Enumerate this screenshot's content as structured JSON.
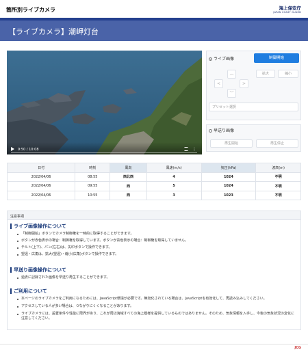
{
  "header": {
    "site_title": "箇所別ライブカメラ",
    "logo_jp": "海上保安庁",
    "logo_en": "JAPAN COAST GUARD"
  },
  "banner": {
    "title": "【ライブカメラ】潮岬灯台"
  },
  "video": {
    "time": "9:50 / 10:08"
  },
  "controls": {
    "live_label": "ライブ画像",
    "control_start": "制御開始",
    "zoom_in": "拡大",
    "zoom_out": "縮小",
    "up": "︿",
    "left": "<",
    "right": ">",
    "down": "﹀",
    "preset_placeholder": "プリセット選択",
    "fast_label": "早送り画像",
    "play_start": "再生開始",
    "play_stop": "再生停止"
  },
  "table": {
    "headers": [
      "日付",
      "時刻",
      "風向",
      "風速(m/s)",
      "気圧(hPa)",
      "波高(m)"
    ],
    "rows": [
      [
        "2022/04/06",
        "08:55",
        "西北西",
        "4",
        "1024",
        "不明"
      ],
      [
        "2022/04/06",
        "09:55",
        "西",
        "5",
        "1024",
        "不明"
      ],
      [
        "2022/04/06",
        "10:55",
        "西",
        "3",
        "1023",
        "不明"
      ]
    ]
  },
  "notes": {
    "header": "注意事項",
    "sections": [
      {
        "title": "ライブ画像操作について",
        "items": [
          "「制御開始」ボタンでカメラ制御権を一時的に取得することができます。",
          "ボタンが赤色表示の場合：制御権を取得しています。ボタンが青色表示の場合：制御権を取得していません。",
          "チルト(上下)、パン(左右)は、矢印ボタンで操作できます。",
          "望遠・広角は、拡大(望遠)・縮小(広角)ボタンで操作できます。"
        ]
      },
      {
        "title": "早送り画像操作について",
        "items": [
          "過去に記録された画像を早送り再生することができます。"
        ]
      },
      {
        "title": "ご利用について",
        "items": [
          "本ページのライブカメラをご利用になるためには、JavaScript環境が必要です。無効化されている場合は、JavaScriptを有効化して、再読み込みしてください。",
          "アクセスしている人が多い場合は、つながりにくくなることがあります。",
          "ライブカメラには、設置条件や性能に限界があり、これが周辺海域すべての海上模様を提供しているものではありません。そのため、気象情報を入手し、今後の気象状況の変化に注意してください。"
        ]
      }
    ]
  },
  "footer": {
    "mark": "JCG"
  }
}
